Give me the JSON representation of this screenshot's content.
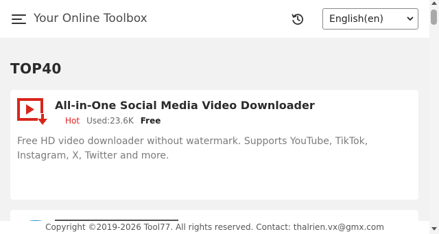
{
  "header": {
    "site_name": "Your Online Toolbox",
    "language": {
      "selected": "English(en)",
      "options": [
        "English(en)"
      ]
    },
    "icons": {
      "menu": "hamburger-menu-icon",
      "history": "history-icon"
    }
  },
  "main": {
    "section_title": "TOP40",
    "tools": [
      {
        "title": "All-in-One Social Media Video Downloader",
        "icon": "video-download-icon",
        "hot_label": "Hot",
        "used_label": "Used:23.6K",
        "price_label": "Free",
        "description": "Free HD video downloader without watermark. Supports YouTube, TikTok, Instagram, X, Twitter and more."
      }
    ]
  },
  "footer": {
    "text": "Copyright ©2019-2026 Tool77. All rights reserved. Contact: thalrien.vx@gmx.com"
  },
  "colors": {
    "accent_red": "#e02020",
    "icon_red": "#d9261c",
    "page_background": "#f2f2f2"
  }
}
